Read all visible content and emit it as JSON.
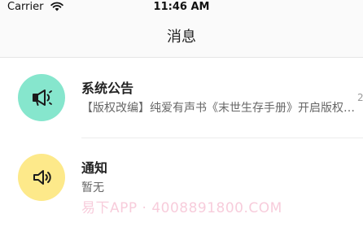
{
  "status_bar": {
    "carrier": "Carrier",
    "time": "11:46 AM"
  },
  "nav": {
    "title": "消息"
  },
  "messages": [
    {
      "title": "系统公告",
      "subtitle": "【版权改编】纯爱有声书《末世生存手册》开启版权改编",
      "time": "2",
      "icon": "megaphone-icon",
      "icon_bg": "#86e6cd"
    },
    {
      "title": "通知",
      "subtitle": "暂无",
      "icon": "speaker-icon",
      "icon_bg": "#fde98a"
    }
  ],
  "watermark": "易下APP · 4008891800.COM"
}
